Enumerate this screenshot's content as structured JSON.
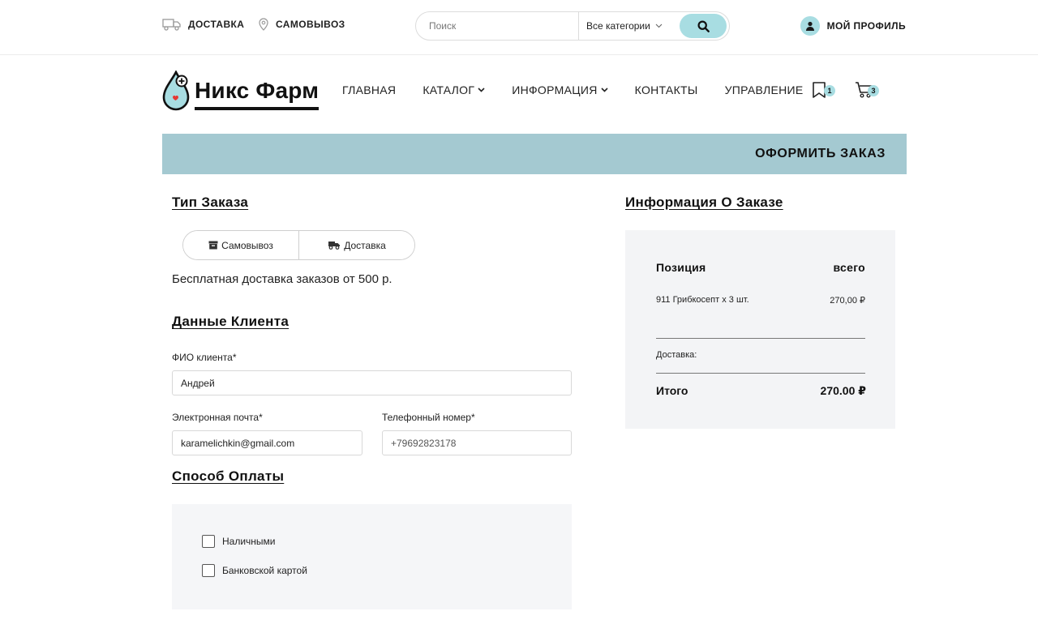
{
  "topbar": {
    "delivery_label": "ДОСТАВКА",
    "pickup_label": "САМОВЫВОЗ",
    "search_placeholder": "Поиск",
    "category_label": "Все категории",
    "profile_label": "МОЙ ПРОФИЛЬ"
  },
  "brand": {
    "logo_text": "Никс Фарм",
    "accent_color": "#a8dde2",
    "banner_color": "#a4c9d1"
  },
  "nav": {
    "items": [
      {
        "label": "ГЛАВНАЯ",
        "has_dropdown": false
      },
      {
        "label": "КАТАЛОГ",
        "has_dropdown": true
      },
      {
        "label": "ИНФОРМАЦИЯ",
        "has_dropdown": true
      },
      {
        "label": "КОНТАКТЫ",
        "has_dropdown": false
      },
      {
        "label": "УПРАВЛЕНИЕ",
        "has_dropdown": false
      }
    ],
    "wishlist_count": "1",
    "cart_count": "3",
    "icons": [
      "bookmark-icon",
      "cart-icon"
    ]
  },
  "banner": {
    "title": "ОФОРМИТЬ ЗАКАЗ"
  },
  "order_type": {
    "title": "Тип Заказа",
    "options": [
      "Самовывоз",
      "Доставка"
    ],
    "note": "Бесплатная доставка заказов от 500 р."
  },
  "client": {
    "title": "Данные Клиента",
    "name_label": "ФИО клиента*",
    "name_value": "Андрей",
    "email_label": "Электронная почта*",
    "email_value": "karamelichkin@gmail.com",
    "phone_label": "Телефонный номер*",
    "phone_placeholder": "+79692823178"
  },
  "payment": {
    "title": "Способ Оплаты",
    "options": [
      "Наличными",
      "Банковской картой"
    ]
  },
  "order_info": {
    "title": "Информация О Заказе",
    "col_item": "Позиция",
    "col_total": "всего",
    "items": [
      {
        "name": "911 Грибкосепт х 3 шт.",
        "price": "270,00 ₽"
      }
    ],
    "delivery_label": "Доставка:",
    "total_label": "Итого",
    "total_value": "270.00 ₽"
  }
}
